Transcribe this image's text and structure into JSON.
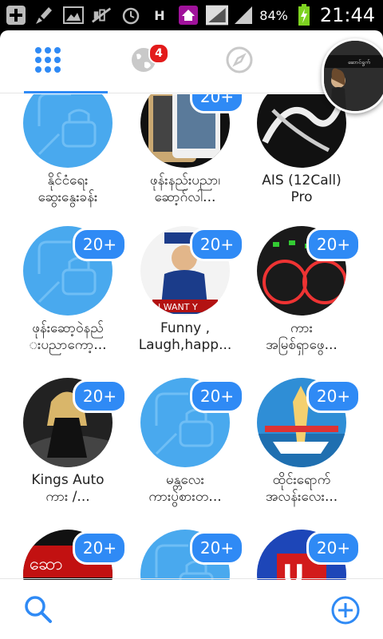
{
  "status_bar": {
    "battery_percent": "84%",
    "time": "21:44",
    "icons": [
      "add-icon",
      "cleaner-icon",
      "gallery-icon",
      "signal-muted-icon",
      "alarm-icon",
      "h-data-icon",
      "home-app-icon",
      "signal-full-icon",
      "signal-icon",
      "battery-charging-icon"
    ]
  },
  "tabs": {
    "badge_count": "4",
    "items": [
      "grid-icon",
      "globe-icon",
      "compass-icon",
      "settings-icon"
    ]
  },
  "cells": [
    {
      "name": "နိုင်ငံရေး\nဆွေးနွေးခန်း",
      "count": "",
      "kind": "default"
    },
    {
      "name": "ဖုန်းနည်းပညာ၊\nဆော့ဂ်လါ...",
      "count": "20+",
      "kind": "phone"
    },
    {
      "name": "AIS (12Call)\nPro",
      "count": "",
      "kind": "dark"
    },
    {
      "name": "ဖုန်းဆော့ဝဲနည်\nးပညာကော့...",
      "count": "20+",
      "kind": "default"
    },
    {
      "name": "Funny ,\nLaugh,happ...",
      "count": "20+",
      "kind": "poster"
    },
    {
      "name": "ကား\nအမြစ်ရှာဖွေ...",
      "count": "20+",
      "kind": "dash"
    },
    {
      "name": "Kings Auto\nကား /...",
      "count": "20+",
      "kind": "car"
    },
    {
      "name": "မန္တလေး\nကားပွဲစားတ...",
      "count": "20+",
      "kind": "default"
    },
    {
      "name": "ထိုင်းရောက်\nအလန်းလေး...",
      "count": "20+",
      "kind": "sea"
    },
    {
      "name": "",
      "count": "20+",
      "kind": "red"
    },
    {
      "name": "",
      "count": "20+",
      "kind": "default"
    },
    {
      "name": "",
      "count": "20+",
      "kind": "unicode"
    }
  ],
  "colors": {
    "accent": "#2f8af5",
    "badge_red": "#e31b1b"
  }
}
